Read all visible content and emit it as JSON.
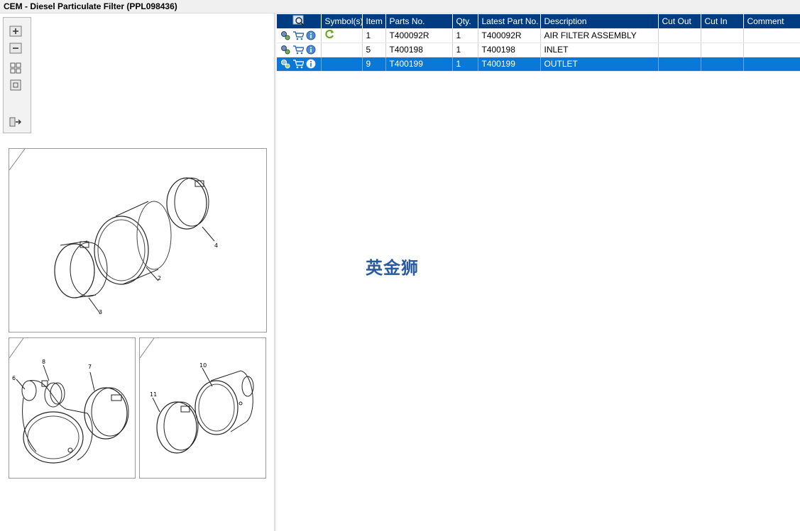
{
  "window": {
    "title": "CEM - Diesel Particulate Filter (PPL098436)"
  },
  "toolbox": {
    "icons": [
      "zoom-in-icon",
      "zoom-out-icon",
      "fit-all-icon",
      "single-view-icon",
      "export-icon"
    ]
  },
  "diagrams": {
    "panel1": {
      "flag_color": "#22dd22",
      "labels": [
        "2",
        "3",
        "4"
      ]
    },
    "panel2": {
      "flag_color": "#22dd22",
      "labels": [
        "6",
        "7",
        "8"
      ]
    },
    "panel3": {
      "flag_color": "#ff8080",
      "labels": [
        "10",
        "11"
      ]
    }
  },
  "table": {
    "columns": [
      "Symbol(s)",
      "Item",
      "Parts No.",
      "Qty.",
      "Latest Part No.",
      "Description",
      "Cut Out",
      "Cut In",
      "Comment"
    ],
    "rows": [
      {
        "item": "1",
        "parts_no": "T400092R",
        "qty": "1",
        "latest": "T400092R",
        "description": "AIR FILTER ASSEMBLY",
        "cut_out": "",
        "cut_in": "",
        "comment": "",
        "symbol": "replace-icon"
      },
      {
        "item": "5",
        "parts_no": "T400198",
        "qty": "1",
        "latest": "T400198",
        "description": "INLET",
        "cut_out": "",
        "cut_in": "",
        "comment": "",
        "symbol": ""
      },
      {
        "item": "9",
        "parts_no": "T400199",
        "qty": "1",
        "latest": "T400199",
        "description": "OUTLET",
        "cut_out": "",
        "cut_in": "",
        "comment": "",
        "symbol": ""
      }
    ],
    "selected_row": 2
  },
  "watermark": "英金狮",
  "colors": {
    "header": "#003c82",
    "selected": "#0a78d7"
  }
}
